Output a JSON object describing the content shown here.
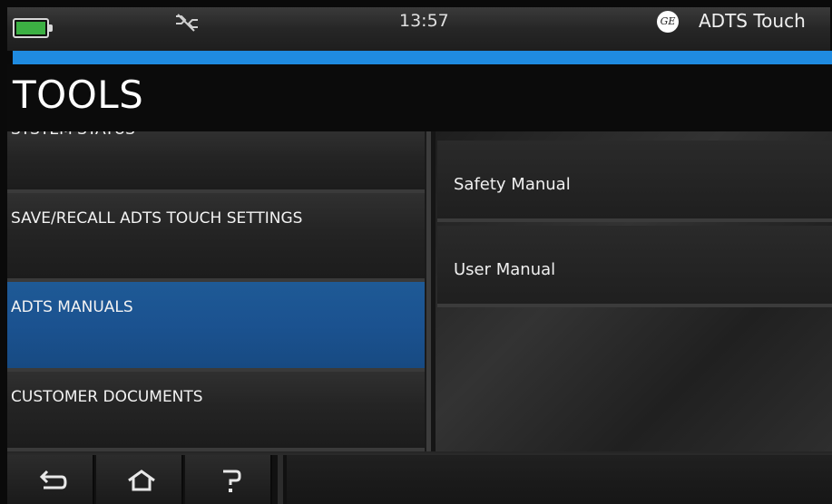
{
  "status_bar": {
    "battery_icon": "battery-icon",
    "battery_level": 0.9,
    "connection_icon": "link-disconnected-icon",
    "time": "13:57",
    "brand_icon": "ge-logo",
    "device_name": "ADTS Touch"
  },
  "colors": {
    "accent": "#1f8be0",
    "selected": "#1b5290",
    "battery": "#3cb043"
  },
  "header": {
    "title": "TOOLS"
  },
  "menu": {
    "items": [
      {
        "label": "SYSTEM STATUS"
      },
      {
        "label": "SAVE/RECALL ADTS TOUCH SETTINGS"
      },
      {
        "label": "ADTS MANUALS",
        "selected": true
      },
      {
        "label": "CUSTOMER DOCUMENTS"
      }
    ]
  },
  "submenu": {
    "items": [
      {
        "label": "Safety Manual"
      },
      {
        "label": "User Manual"
      }
    ]
  },
  "nav": {
    "back_icon": "back-arrow-icon",
    "home_icon": "home-icon",
    "help_icon": "help-icon"
  }
}
